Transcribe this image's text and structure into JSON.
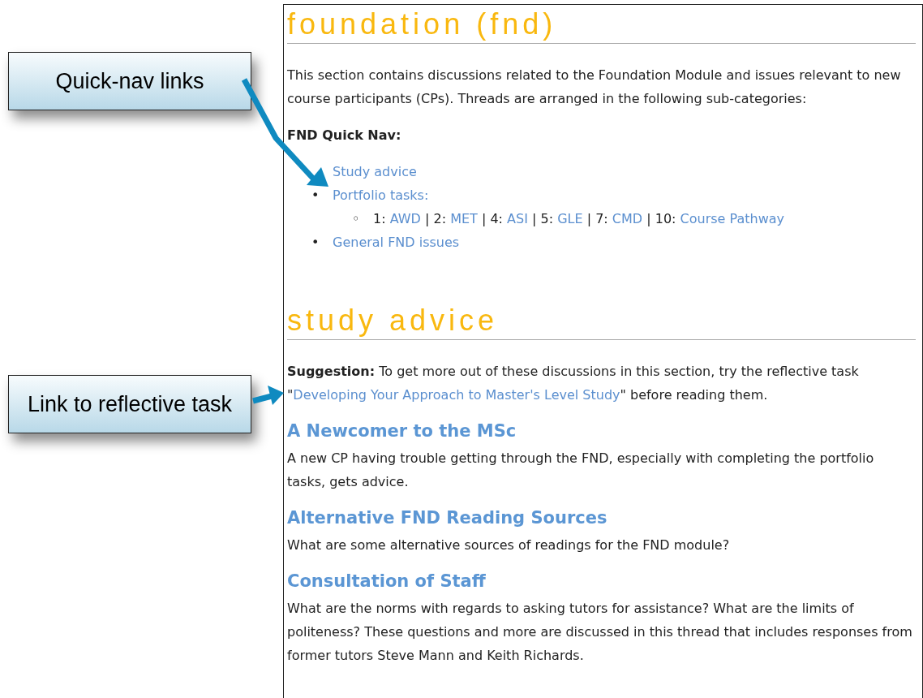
{
  "callouts": [
    {
      "text": "Quick-nav links"
    },
    {
      "text": "Link to reflective task"
    }
  ],
  "page": {
    "title": "foundation (fnd)",
    "intro": "This section contains discussions related to the Foundation Module and issues relevant to new course participants (CPs). Threads are arranged in the following sub-categories:",
    "quick_nav_label": "FND Quick Nav:",
    "quick_nav": [
      {
        "label": "Study advice"
      },
      {
        "marker": "•",
        "label": "Portfolio tasks:",
        "sub_marker": "◦",
        "children": [
          {
            "kind": "text",
            "text": "1:"
          },
          {
            "kind": "link",
            "text": "AWD"
          },
          {
            "kind": "text",
            "text": "|"
          },
          {
            "kind": "text",
            "text": "2:"
          },
          {
            "kind": "link",
            "text": "MET"
          },
          {
            "kind": "text",
            "text": "|"
          },
          {
            "kind": "text",
            "text": "4:"
          },
          {
            "kind": "link",
            "text": "ASI"
          },
          {
            "kind": "text",
            "text": "|"
          },
          {
            "kind": "text",
            "text": "5:"
          },
          {
            "kind": "link",
            "text": "GLE"
          },
          {
            "kind": "text",
            "text": "|"
          },
          {
            "kind": "text",
            "text": "7:"
          },
          {
            "kind": "link",
            "text": "CMD"
          },
          {
            "kind": "text",
            "text": "|"
          },
          {
            "kind": "text",
            "text": "10:"
          },
          {
            "kind": "link",
            "text": "Course Pathway"
          }
        ]
      },
      {
        "marker": "•",
        "label": "General FND issues"
      }
    ],
    "section_title": "study advice",
    "suggestion": {
      "before": "**Suggestion:** To get more out of these discussions in this section, try the reflective task \"",
      "link": "Developing Your Approach to Master's Level Study",
      "after": "\" before reading them."
    },
    "threads": [
      {
        "title": "A Newcomer to the MSc",
        "description": "A new CP having trouble getting through the FND, especially with completing the portfolio tasks, gets advice."
      },
      {
        "title": "Alternative FND Reading Sources",
        "description": "What are some alternative sources of readings for the FND module?"
      },
      {
        "title": "Consultation of Staff",
        "description": "What are the norms with regards to asking tutors for assistance? What are the limits of politeness? These questions and more are discussed in this thread that includes responses from former tutors Steve Mann and Keith Richards."
      }
    ]
  }
}
